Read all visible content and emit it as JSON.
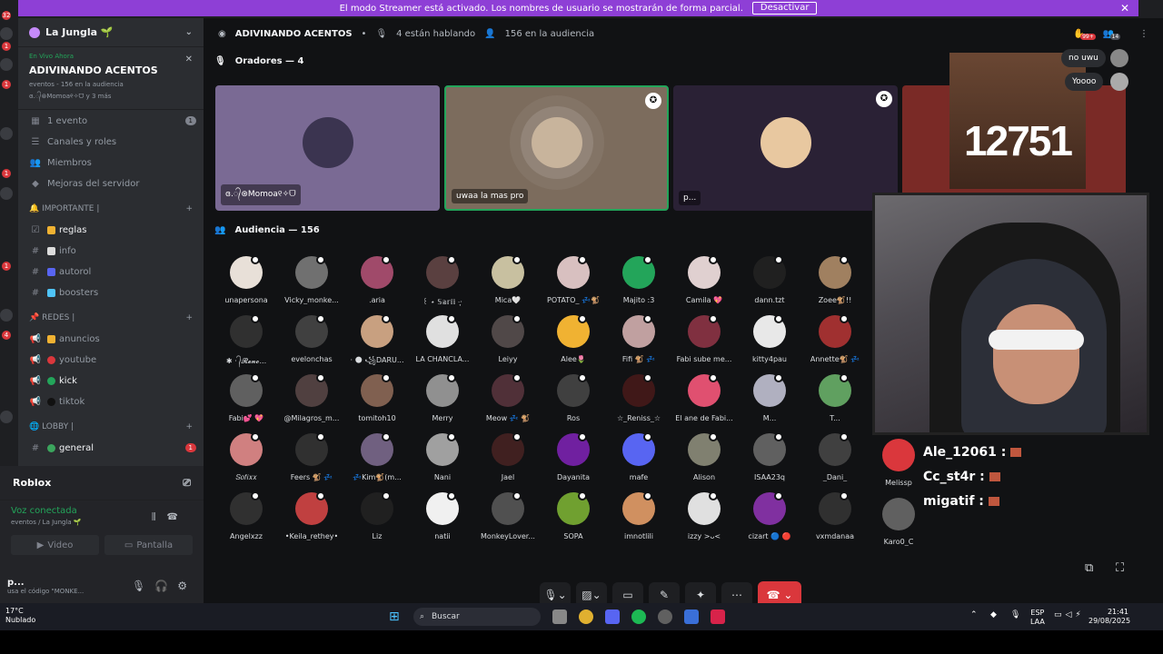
{
  "banner": {
    "text": "El modo Streamer está activado. Los nombres de usuario se mostrarán de forma parcial.",
    "button": "Desactivar",
    "close": "✕"
  },
  "server_badges": [
    "32",
    "1",
    "1",
    "1",
    "1",
    "1",
    "4",
    "1"
  ],
  "guild": {
    "name": "La Jungla 🌱",
    "chevron": "⌄"
  },
  "stage_live": {
    "tag": "En Vivo Ahora",
    "title": "ADIVINANDO ACENTOS",
    "meta": "eventos - 156 en la audiencia",
    "speakers": "ɞ.᭄⊛Momoa୧✧ᗜ y 3 más",
    "close": "✕"
  },
  "nav": [
    {
      "label": "1 evento",
      "count": "1",
      "icon": "calendar-icon"
    },
    {
      "label": "Canales y roles",
      "icon": "list-icon"
    },
    {
      "label": "Miembros",
      "icon": "members-icon"
    },
    {
      "label": "Mejoras del servidor",
      "icon": "boost-icon"
    }
  ],
  "categories": {
    "importante": "IMPORTANTE |",
    "redes": "REDES |",
    "lobby": "LOBBY |"
  },
  "channels_importante": [
    {
      "label": "reglas",
      "color": "#f0b232"
    },
    {
      "label": "info",
      "color": "#dcdcdc"
    },
    {
      "label": "autorol",
      "color": "#5865f2"
    },
    {
      "label": "boosters",
      "color": "#4fc3f7"
    }
  ],
  "channels_redes": [
    {
      "label": "anuncios",
      "color": "#f0b232"
    },
    {
      "label": "youtube",
      "color": "#da373c"
    },
    {
      "label": "kick",
      "color": "#23a55a"
    },
    {
      "label": "tiktok",
      "color": "#111111"
    }
  ],
  "channels_lobby": [
    {
      "label": "general",
      "count": "1",
      "color": "#3ba55d"
    }
  ],
  "activity": {
    "label": "Roblox"
  },
  "voice": {
    "status": "Voz conectada",
    "location": "eventos / La Jungla 🌱",
    "video": "Video",
    "screen": "Pantalla"
  },
  "user": {
    "name": "p...",
    "status": "usa el código \"MONKE..."
  },
  "topbar": {
    "title": "ADIVINANDO ACENTOS",
    "speaking": "4 están hablando",
    "audience": "156 en la audiencia"
  },
  "top_right": {
    "badge1": "99+",
    "badge2": "14"
  },
  "speakers_section": "Oradores — 4",
  "speakers": [
    {
      "label": "ɞ.᭄⊛Momoa୧✧ᗜ",
      "bg": "#7a6a94",
      "av": "#3b3450"
    },
    {
      "label": "uwaa la mas pro",
      "bg": "#7c6c5d",
      "av": "#c8b49c"
    },
    {
      "label": "p...",
      "bg": "#2a2135",
      "av": "#e8c8a0"
    },
    {
      "label": "",
      "bg": "#7a2a26",
      "av": "#7a2a26"
    }
  ],
  "audience_section": "Audiencia — 156",
  "audience": [
    [
      "unapersona",
      "Vicky_monke...",
      ".aria",
      "꒰ ⋆ 𝕊𝕒𝕣𝕚𝕚 ·̩͙·",
      "Mica🤍",
      "POTATO_ 💤🐒",
      "Majito :3",
      "Camila 💖",
      "dann.tzt",
      "Zoee🐒!!"
    ],
    [
      "✱ · ᭄𝓡𝓮𝓷𝓸...",
      "evelonchas",
      "· 🌑 ꧁DARU...",
      "LA CHANCLA...",
      "Leiyy",
      "Alee🌷",
      "Fifi 🐒 💤",
      "Fabi sube me...",
      "kitty4pau",
      "Annette🐒 💤"
    ],
    [
      "Fabi💕 💖",
      "@Milagros_m...",
      "tomitoh10",
      "Merry",
      "Meow 💤 🐒",
      "Ros",
      "☆_Reniss_☆",
      "El ane de Fabi...",
      "M...",
      "T..."
    ],
    [
      "𝑆𝑜𝑓𝑖𝑥𝑥",
      "Feers 🐒 💤",
      "💤Kim🐒(m...",
      "Nani",
      "Jael",
      "Dayanita",
      "mafe",
      "Alison",
      "ISAA23q",
      "_Dani_"
    ],
    [
      "Angelxzz",
      "•Keila_rethey•",
      "Liz",
      "natii",
      "MonkeyLover...",
      "SOPA",
      "imnotlili",
      "izzy >ᴗ<",
      "cizart 🔵 🔴",
      "vxmdanaa"
    ]
  ],
  "audience_colors": [
    [
      "#e8e0d8",
      "#707070",
      "#a04a6a",
      "#5a4040",
      "#c8c0a0",
      "#d8c0c0",
      "#23a55a",
      "#e0d0d0",
      "#202020",
      "#a08060"
    ],
    [
      "#303030",
      "#404040",
      "#c8a080",
      "#e0e0e0",
      "#504848",
      "#f0b232",
      "#c0a0a0",
      "#803040",
      "#e8e8e8",
      "#a03030"
    ],
    [
      "#606060",
      "#504040",
      "#806050",
      "#909090",
      "#503038",
      "#404040",
      "#401818",
      "#e05070",
      "#b0b0c0",
      "#60a060"
    ],
    [
      "#d08080",
      "#303030",
      "#706080",
      "#a0a0a0",
      "#402020",
      "#7020a0",
      "#5865f2",
      "#808070",
      "#606060",
      "#404040"
    ],
    [
      "#303030",
      "#c04040",
      "#202020",
      "#f0f0f0",
      "#505050",
      "#70a030",
      "#d09060",
      "#e0e0e0",
      "#8030a0",
      "#303030"
    ]
  ],
  "extra_names": {
    "melissp": "Melissp",
    "karo": "Karo0_C"
  },
  "overlay": {
    "counter": "12751"
  },
  "chat_bubbles": [
    "no uwu",
    "Yoooo"
  ],
  "chat_lines": [
    "Ale_12061 :",
    "Cc_st4r :",
    "migatif :"
  ],
  "taskbar": {
    "weather_temp": "17°C",
    "weather_desc": "Nublado",
    "search": "Buscar",
    "lang1": "ESP",
    "lang2": "LAA",
    "time": "21:41",
    "date": "29/08/2025"
  }
}
